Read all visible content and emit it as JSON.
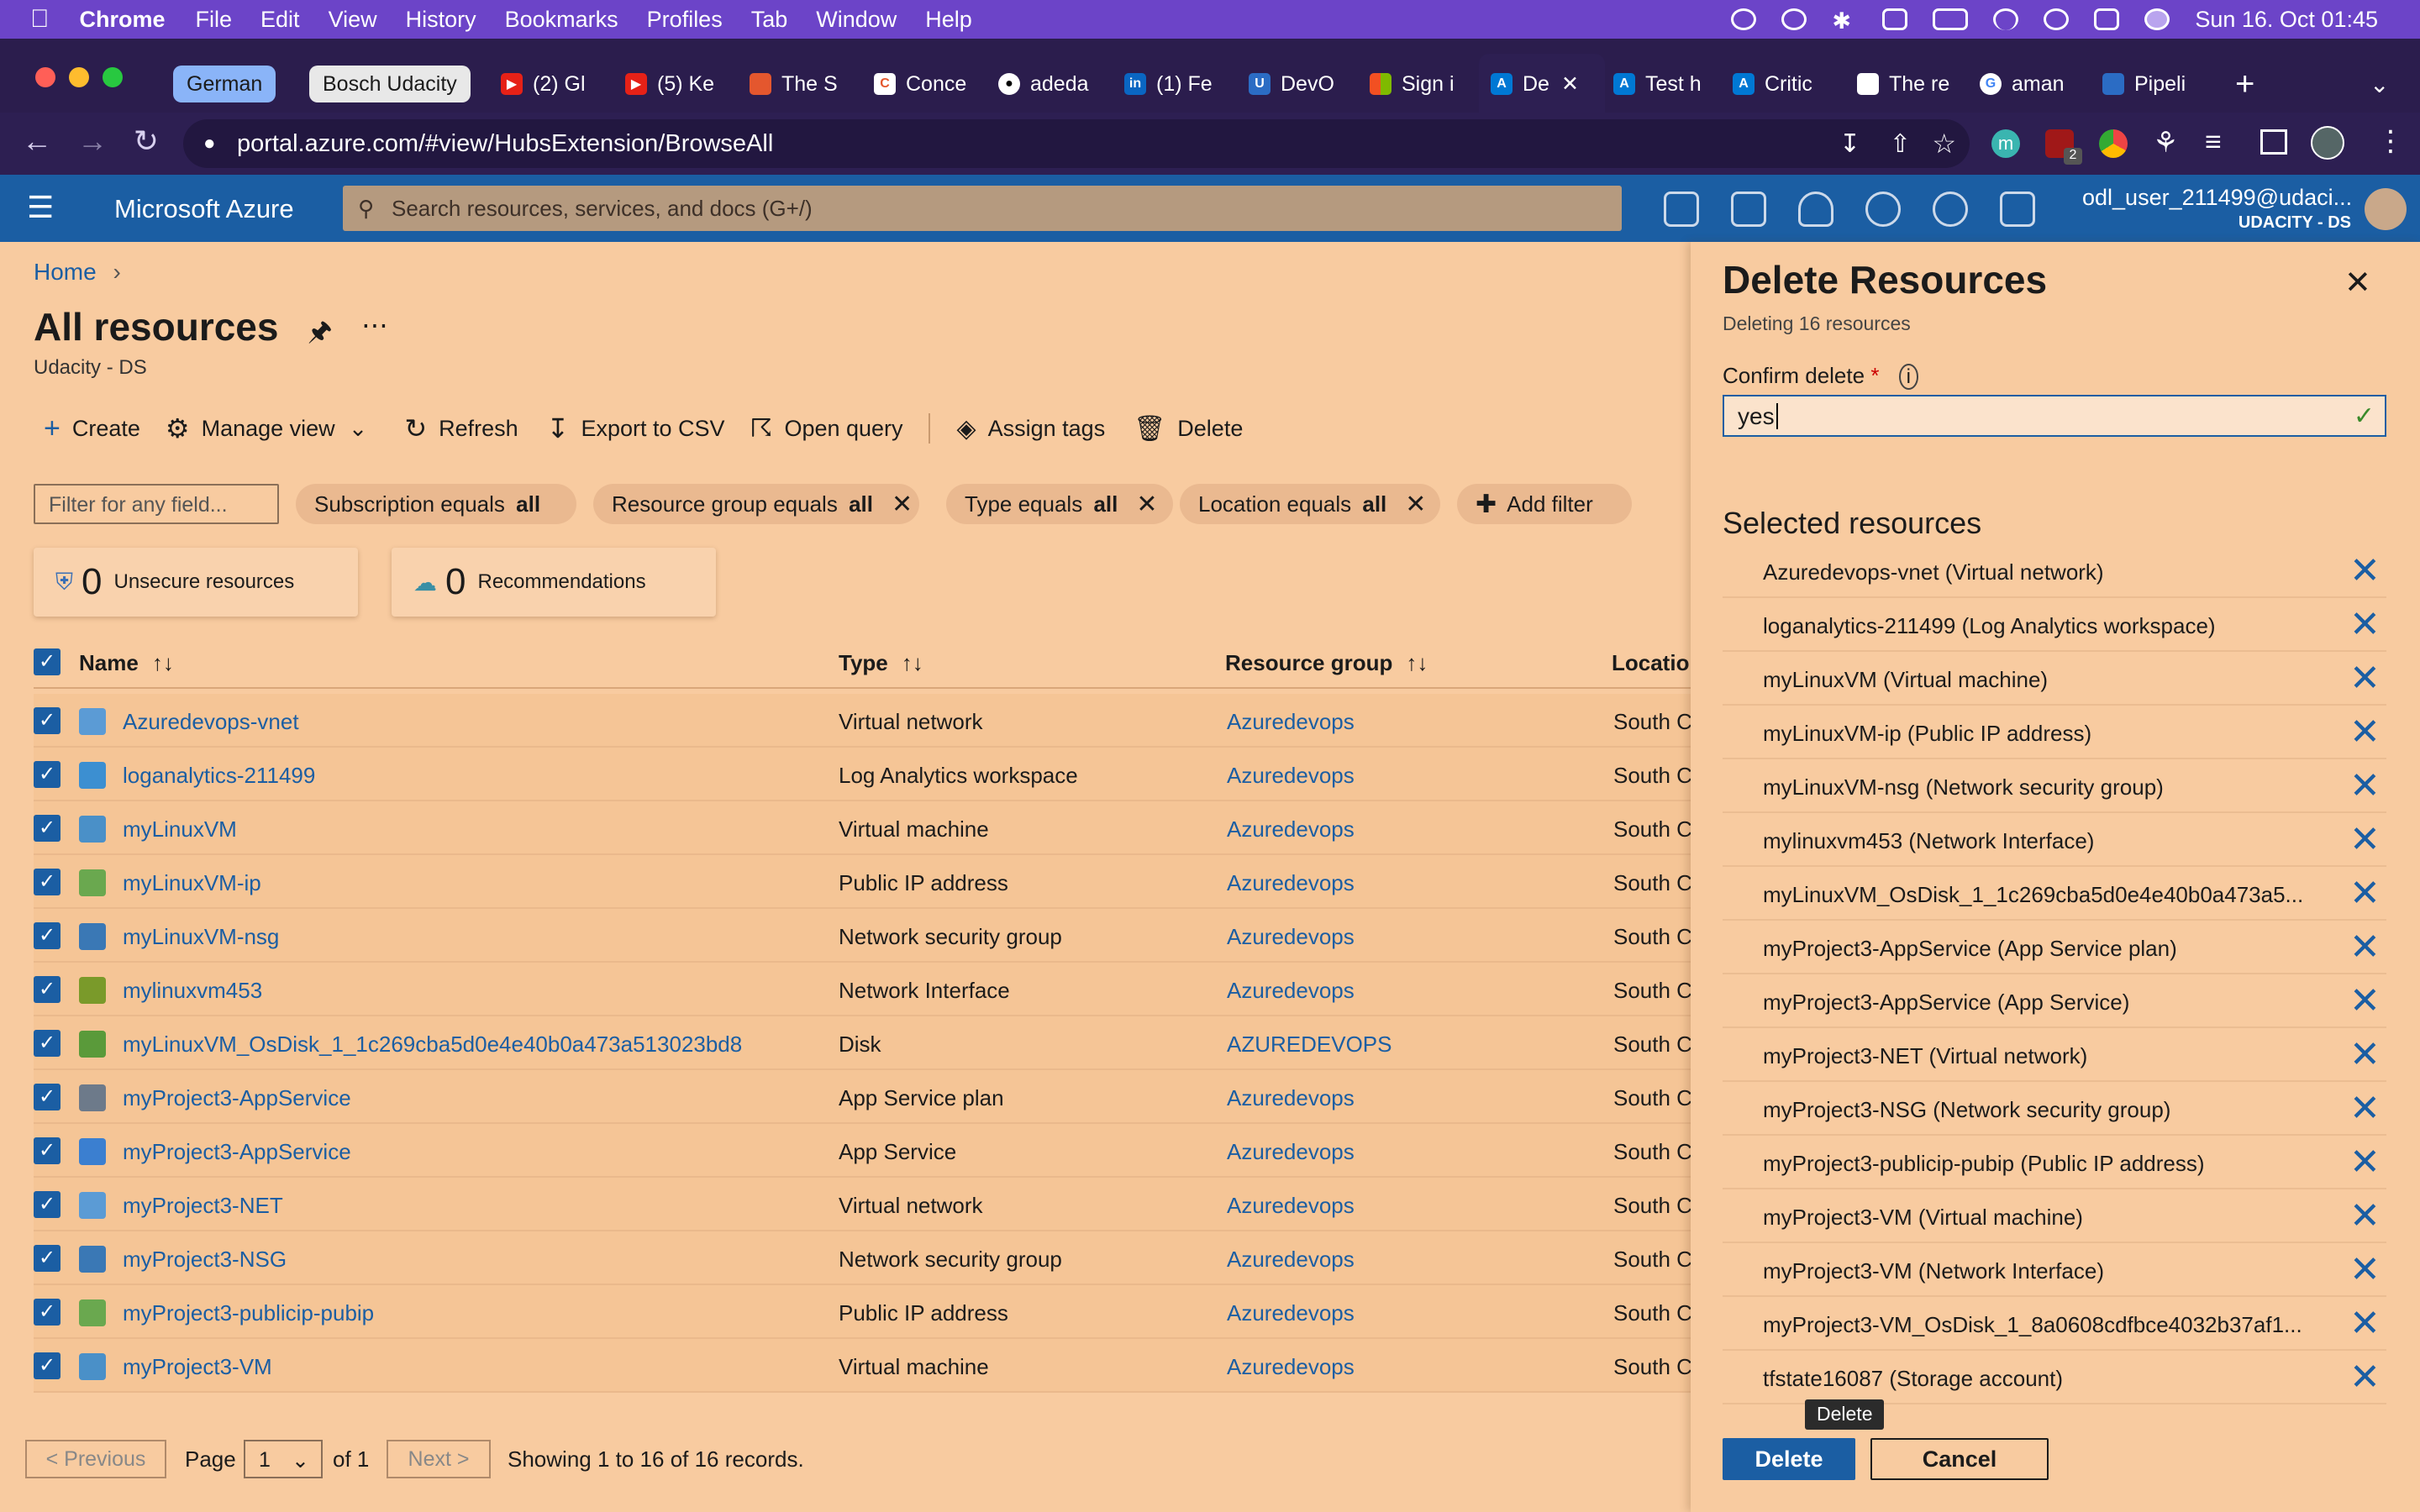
{
  "menubar": {
    "app": "Chrome",
    "items": [
      "File",
      "Edit",
      "View",
      "History",
      "Bookmarks",
      "Profiles",
      "Tab",
      "Window",
      "Help"
    ],
    "datetime": "Sun 16. Oct  01:45"
  },
  "tabs": {
    "groups": [
      "German",
      "Bosch Udacity"
    ],
    "items": [
      "(2) Gl",
      "(5) Ke",
      "The S",
      "Conce",
      "adeda",
      "(1) Fe",
      "DevO",
      "Sign i",
      "De",
      "Test h",
      "Critic",
      "The re",
      "aman",
      "Pipeli"
    ]
  },
  "browser": {
    "url": "portal.azure.com/#view/HubsExtension/BrowseAll",
    "badge": "2"
  },
  "azure": {
    "brand": "Microsoft Azure",
    "search_placeholder": "Search resources, services, and docs (G+/)",
    "user": "odl_user_211499@udaci...",
    "tenant": "UDACITY - DS"
  },
  "page": {
    "breadcrumb_home": "Home",
    "title": "All resources",
    "subtitle": "Udacity - DS"
  },
  "toolbar": {
    "create": "Create",
    "manage_view": "Manage view",
    "refresh": "Refresh",
    "export": "Export to CSV",
    "open_query": "Open query",
    "assign_tags": "Assign tags",
    "delete": "Delete"
  },
  "filters": {
    "placeholder": "Filter for any field...",
    "subscription": "Subscription equals ",
    "resource_group": "Resource group equals ",
    "type": "Type equals ",
    "location": "Location equals ",
    "all": "all",
    "add_filter": "Add filter"
  },
  "cards": {
    "unsecure_count": "0",
    "unsecure_label": "Unsecure resources",
    "recs_count": "0",
    "recs_label": "Recommendations"
  },
  "table": {
    "headers": {
      "name": "Name",
      "type": "Type",
      "resource_group": "Resource group",
      "location": "Location"
    },
    "rows": [
      {
        "name": "Azuredevops-vnet",
        "type": "Virtual network",
        "rg": "Azuredevops",
        "loc": "South C",
        "icon": "vnet-icon",
        "color": "#5b9bd5"
      },
      {
        "name": "loganalytics-211499",
        "type": "Log Analytics workspace",
        "rg": "Azuredevops",
        "loc": "South C",
        "icon": "log-analytics-icon",
        "color": "#3c8fd1"
      },
      {
        "name": "myLinuxVM",
        "type": "Virtual machine",
        "rg": "Azuredevops",
        "loc": "South C",
        "icon": "virtual-machine-icon",
        "color": "#4a90c8"
      },
      {
        "name": "myLinuxVM-ip",
        "type": "Public IP address",
        "rg": "Azuredevops",
        "loc": "South C",
        "icon": "public-ip-icon",
        "color": "#6aa84f"
      },
      {
        "name": "myLinuxVM-nsg",
        "type": "Network security group",
        "rg": "Azuredevops",
        "loc": "South C",
        "icon": "nsg-icon",
        "color": "#3a78b5"
      },
      {
        "name": "mylinuxvm453",
        "type": "Network Interface",
        "rg": "Azuredevops",
        "loc": "South C",
        "icon": "nic-icon",
        "color": "#7a9a2a"
      },
      {
        "name": "myLinuxVM_OsDisk_1_1c269cba5d0e4e40b0a473a513023bd8",
        "type": "Disk",
        "rg": "AZUREDEVOPS",
        "loc": "South C",
        "icon": "disk-icon",
        "color": "#5a9a3a"
      },
      {
        "name": "myProject3-AppService",
        "type": "App Service plan",
        "rg": "Azuredevops",
        "loc": "South C",
        "icon": "app-service-plan-icon",
        "color": "#6d7a8a"
      },
      {
        "name": "myProject3-AppService",
        "type": "App Service",
        "rg": "Azuredevops",
        "loc": "South C",
        "icon": "app-service-icon",
        "color": "#3b7fd0"
      },
      {
        "name": "myProject3-NET",
        "type": "Virtual network",
        "rg": "Azuredevops",
        "loc": "South C",
        "icon": "vnet-icon",
        "color": "#5b9bd5"
      },
      {
        "name": "myProject3-NSG",
        "type": "Network security group",
        "rg": "Azuredevops",
        "loc": "South C",
        "icon": "nsg-icon",
        "color": "#3a78b5"
      },
      {
        "name": "myProject3-publicip-pubip",
        "type": "Public IP address",
        "rg": "Azuredevops",
        "loc": "South C",
        "icon": "public-ip-icon",
        "color": "#6aa84f"
      },
      {
        "name": "myProject3-VM",
        "type": "Virtual machine",
        "rg": "Azuredevops",
        "loc": "South C",
        "icon": "virtual-machine-icon",
        "color": "#4a90c8"
      }
    ]
  },
  "pagination": {
    "previous": "< Previous",
    "page_label": "Page",
    "page_value": "1",
    "of": "of 1",
    "next": "Next >",
    "showing": "Showing 1 to 16 of 16 records."
  },
  "panel": {
    "title": "Delete Resources",
    "subtitle": "Deleting 16 resources",
    "confirm_label": "Confirm delete",
    "required_mark": "*",
    "confirm_value": "yes",
    "selected_heading": "Selected resources",
    "selected": [
      "Azuredevops-vnet  (Virtual network)",
      "loganalytics-211499  (Log Analytics workspace)",
      "myLinuxVM  (Virtual machine)",
      "myLinuxVM-ip  (Public IP address)",
      "myLinuxVM-nsg  (Network security group)",
      "mylinuxvm453  (Network Interface)",
      "myLinuxVM_OsDisk_1_1c269cba5d0e4e40b0a473a5...",
      "myProject3-AppService  (App Service plan)",
      "myProject3-AppService  (App Service)",
      "myProject3-NET  (Virtual network)",
      "myProject3-NSG  (Network security group)",
      "myProject3-publicip-pubip  (Public IP address)",
      "myProject3-VM  (Virtual machine)",
      "myProject3-VM  (Network Interface)",
      "myProject3-VM_OsDisk_1_8a0608cdfbce4032b37af1...",
      "tfstate16087  (Storage account)"
    ],
    "tooltip": "Delete",
    "delete_button": "Delete",
    "cancel_button": "Cancel"
  },
  "colors": {
    "azure_blue": "#1b5ea3",
    "menubar": "#6c44c8",
    "panel_bg": "#f8cba0"
  }
}
